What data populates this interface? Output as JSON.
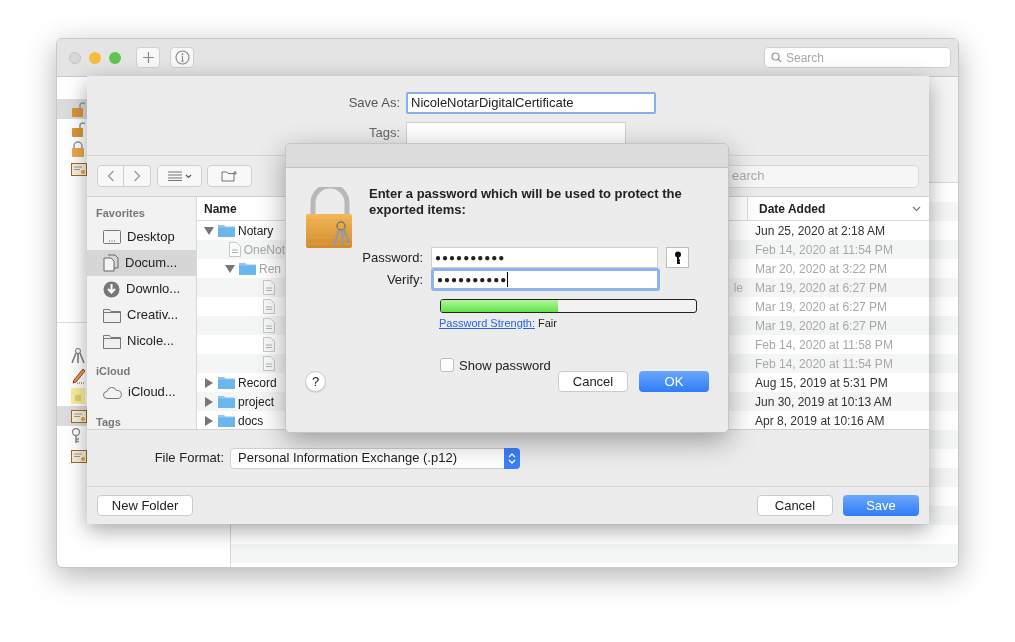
{
  "keychain_window": {
    "search": {
      "placeholder": "Search"
    },
    "sidebar_groups": [
      {
        "items": [
          {
            "kind": "lock-open",
            "selected": true
          },
          {
            "kind": "lock-open",
            "selected": false
          },
          {
            "kind": "lock-closed",
            "selected": false
          },
          {
            "kind": "certificate",
            "selected": false
          }
        ]
      },
      {
        "items": [
          {
            "kind": "person-keys",
            "selected": false
          },
          {
            "kind": "pen",
            "selected": false
          },
          {
            "kind": "note",
            "selected": false
          },
          {
            "kind": "certificate",
            "selected": true
          },
          {
            "kind": "key",
            "selected": false
          },
          {
            "kind": "certificate",
            "selected": false
          }
        ]
      }
    ]
  },
  "save_sheet": {
    "save_as": {
      "label": "Save As:",
      "value": "NicoleNotarDigitalCertificate"
    },
    "tags": {
      "label": "Tags:"
    },
    "search": {
      "placeholder": "earch"
    },
    "sidebar": [
      {
        "title": "Favorites",
        "items": [
          {
            "kind": "desktop",
            "label": "Desktop",
            "selected": false
          },
          {
            "kind": "documents",
            "label": "Docum...",
            "selected": true
          },
          {
            "kind": "downloads",
            "label": "Downlo...",
            "selected": false
          },
          {
            "kind": "folder",
            "label": "Creativ...",
            "selected": false
          },
          {
            "kind": "folder",
            "label": "Nicole...",
            "selected": false
          }
        ]
      },
      {
        "title": "iCloud",
        "items": [
          {
            "kind": "cloud",
            "label": "iCloud...",
            "selected": false
          }
        ]
      },
      {
        "title": "Tags"
      }
    ],
    "columns": [
      {
        "label": "Name"
      },
      {
        "label": "Date Added"
      }
    ],
    "rows": [
      {
        "kind": "folder",
        "name": "Notary",
        "expanded": true,
        "disabled": false,
        "date": "Jun 25, 2020 at 2:18 AM",
        "children": [
          {
            "kind": "file",
            "name": "OneNot",
            "disabled": true,
            "date": "Feb 14, 2020 at 11:54 PM"
          },
          {
            "kind": "folder",
            "name": "Ren",
            "expanded": true,
            "disabled": true,
            "date": "Mar 20, 2020 at 3:22 PM",
            "children": [
              {
                "kind": "file",
                "disabled": true,
                "column_3": "le",
                "date": "Mar 19, 2020 at 6:27 PM"
              },
              {
                "kind": "file",
                "disabled": true,
                "date": "Mar 19, 2020 at 6:27 PM"
              },
              {
                "kind": "file",
                "disabled": true,
                "date": "Mar 19, 2020 at 6:27 PM"
              },
              {
                "kind": "file",
                "disabled": true,
                "date": "Feb 14, 2020 at 11:58 PM"
              },
              {
                "kind": "file",
                "disabled": true,
                "date": "Feb 14, 2020 at 11:54 PM"
              }
            ]
          }
        ]
      },
      {
        "kind": "folder",
        "name": "Record",
        "expanded": false,
        "disabled": false,
        "date": "Aug 15, 2019 at 5:31 PM"
      },
      {
        "kind": "folder",
        "name": "project",
        "expanded": false,
        "disabled": false,
        "date": "Jun 30, 2019 at 10:13 AM"
      },
      {
        "kind": "folder",
        "name": "docs",
        "expanded": false,
        "disabled": false,
        "date": "Apr 8, 2019 at 10:16 AM"
      }
    ],
    "file_format": {
      "label": "File Format:",
      "value": "Personal Information Exchange (.p12)"
    },
    "buttons": [
      {
        "label": "New Folder",
        "default": false
      },
      {
        "label": "Cancel",
        "default": false
      },
      {
        "label": "Save",
        "default": true
      }
    ]
  },
  "password_dialog": {
    "message": "Enter a password which will be used to protect the exported items:",
    "password": {
      "label": "Password:",
      "value": "●●●●●●●●●●",
      "focused": false
    },
    "verify": {
      "label": "Verify:",
      "value": "●●●●●●●●●●",
      "focused": true
    },
    "strength": {
      "level": 0.46,
      "link": "Password Strength:",
      "value": "Fair"
    },
    "show_password": {
      "label": "Show password",
      "checked": false
    },
    "help": "?",
    "buttons": [
      {
        "label": "Cancel",
        "default": false
      },
      {
        "label": "OK",
        "default": true
      }
    ]
  }
}
